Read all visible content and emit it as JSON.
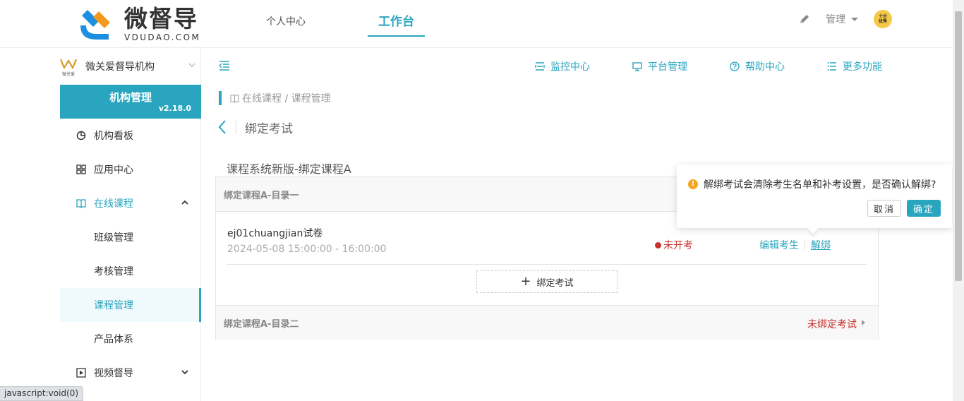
{
  "header": {
    "logo_cn": "微督导",
    "logo_en": "VDUDAO.COM",
    "nav": [
      {
        "label": "个人中心"
      },
      {
        "label": "工作台"
      }
    ],
    "admin_label": "管理",
    "avatar_line1": "十分",
    "avatar_line2": "优秀"
  },
  "sidebar": {
    "org_logo_text": "微关爱",
    "org_name": "微关爱督导机构",
    "panel_title": "机构管理",
    "version": "v2.18.0",
    "items": [
      {
        "label": "机构看板"
      },
      {
        "label": "应用中心"
      },
      {
        "label": "在线课程"
      },
      {
        "label": "班级管理"
      },
      {
        "label": "考核管理"
      },
      {
        "label": "课程管理"
      },
      {
        "label": "产品体系"
      },
      {
        "label": "视频督导"
      }
    ]
  },
  "toolbar": {
    "links": [
      {
        "label": "监控中心"
      },
      {
        "label": "平台管理"
      },
      {
        "label": "帮助中心"
      },
      {
        "label": "更多功能"
      }
    ]
  },
  "breadcrumb": "在线课程 / 课程管理",
  "page_title": "绑定考试",
  "course_name": "课程系统新版-绑定课程A",
  "sections": [
    {
      "title": "绑定课程A-目录一",
      "exam": {
        "name": "ej01chuangjian试卷",
        "time": "2024-05-08 15:00:00 - 16:00:00",
        "status": "未开考",
        "edit_label": "编辑考生",
        "unbind_label": "解绑"
      },
      "bind_label": "绑定考试"
    },
    {
      "title": "绑定课程A-目录二",
      "status": "未绑定考试"
    }
  ],
  "popconfirm": {
    "message": "解绑考试会清除考生名单和补考设置，是否确认解绑?",
    "cancel": "取消",
    "ok": "确定"
  },
  "statusbar": "javascript:void(0)",
  "colors": {
    "accent": "#2aa5bf",
    "danger": "#c8302c",
    "warning": "#f5a623"
  }
}
